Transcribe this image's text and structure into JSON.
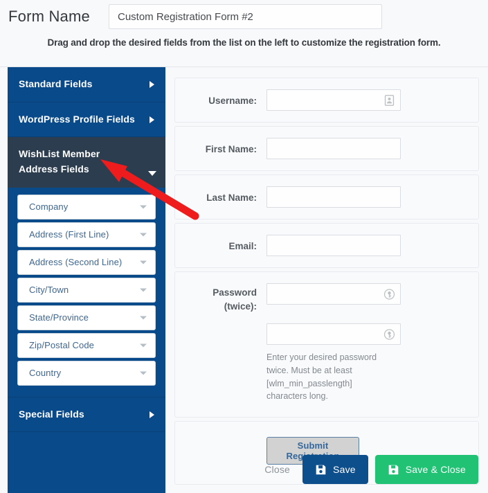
{
  "header": {
    "form_name_label": "Form Name",
    "form_name_value": "Custom Registration Form #2",
    "form_name_placeholder": "Form Name",
    "hint": "Drag and drop the desired fields from the list on the left to customize the registration form."
  },
  "sidebar": {
    "sections": [
      {
        "label": "Standard Fields",
        "state": "collapsed",
        "caret": "caret-right-icon"
      },
      {
        "label": "WordPress Profile Fields",
        "state": "collapsed",
        "caret": "caret-right-icon"
      },
      {
        "label": "WishList Member Address Fields",
        "state": "expanded",
        "caret": "caret-down-icon"
      }
    ],
    "address_fields": [
      "Company",
      "Address (First Line)",
      "Address (Second Line)",
      "City/Town",
      "State/Province",
      "Zip/Postal Code",
      "Country"
    ],
    "special_section": {
      "label": "Special Fields",
      "state": "collapsed",
      "caret": "caret-right-icon"
    }
  },
  "form": {
    "fields": [
      {
        "label": "Username:",
        "value": "",
        "icon": "autofill-contact-icon"
      },
      {
        "label": "First Name:",
        "value": "",
        "icon": ""
      },
      {
        "label": "Last Name:",
        "value": "",
        "icon": ""
      },
      {
        "label": "Email:",
        "value": "",
        "icon": ""
      }
    ],
    "password": {
      "label_line1": "Password",
      "label_line2": "(twice):",
      "value1": "",
      "value2": "",
      "icon": "key-autofill-icon",
      "helper": "Enter your desired password twice. Must be at least [wlm_min_passlength] characters long."
    },
    "submit_label": "Submit Registration"
  },
  "footer": {
    "close_label": "Close",
    "save_label": "Save",
    "save_close_label": "Save & Close",
    "save_icon": "floppy-disk-icon",
    "save_close_icon": "floppy-disk-icon"
  },
  "annotation": {
    "type": "arrow",
    "color": "#ee1c1c",
    "points_to": "WishList Member Address Fields"
  },
  "colors": {
    "sidebar_blue": "#094a8b",
    "sidebar_active_navy": "#2b3d4f",
    "save_blue": "#0d4e8c",
    "save_close_green": "#22c274",
    "annotation_red": "#ee1c1c"
  }
}
